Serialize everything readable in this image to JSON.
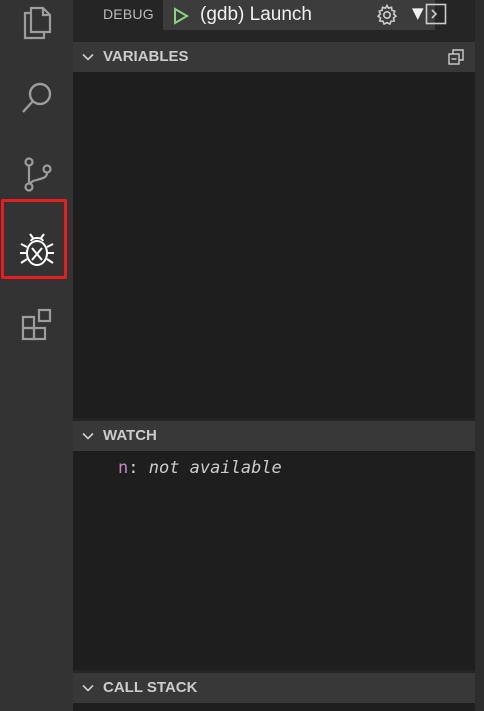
{
  "debug": {
    "label": "DEBUG",
    "configuration": "(gdb) Launch",
    "dropdown_arrow": "▼"
  },
  "sections": {
    "variables": {
      "title": "VARIABLES"
    },
    "watch": {
      "title": "WATCH",
      "items": [
        {
          "name": "n",
          "value": "not available"
        }
      ]
    },
    "call_stack": {
      "title": "CALL STACK"
    }
  },
  "colors": {
    "activity_bar": "#333333",
    "sidebar": "#252526",
    "section_header": "#383838",
    "panel_body": "#1e1e1e",
    "highlight": "#e51e1e",
    "play_green": "#89d185",
    "watch_name": "#c586c0"
  },
  "icons": {
    "activity_bar": [
      "files-icon",
      "search-icon",
      "source-control-icon",
      "debug-icon",
      "extensions-icon"
    ]
  }
}
